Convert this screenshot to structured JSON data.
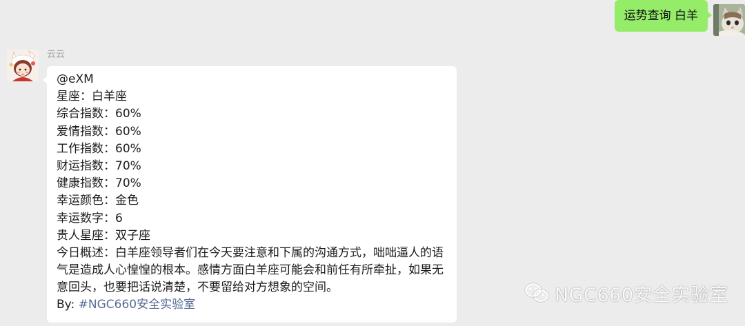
{
  "outgoing": {
    "text": "运势查询 白羊",
    "bubble_color": "#95ec69"
  },
  "incoming": {
    "sender": "云云",
    "lines": {
      "mention": "@eXM",
      "sign": "星座：白羊座",
      "overall": "综合指数：60%",
      "love": "爱情指数：60%",
      "work": "工作指数：60%",
      "wealth": "财运指数：70%",
      "health": "健康指数：70%",
      "lucky_color": "幸运颜色：金色",
      "lucky_number": "幸运数字：6",
      "noble_sign": "贵人星座：双子座",
      "summary": "今日概述：白羊座领导者们在今天要注意和下属的沟通方式，咄咄逼人的语气是造成人心惶惶的根本。感情方面白羊座可能会和前任有所牵扯，如果无意回头，也要把话说清楚，不要留给对方想象的空间。",
      "by_prefix": "By: ",
      "by_tag": "#NGC660安全实验室"
    },
    "hashtag_color": "#576b95"
  },
  "watermark": {
    "text": "NGC660安全实验室",
    "icon": "wechat-icon"
  },
  "avatars": {
    "self": "cat-avatar",
    "sender": "cartoon-girl-avatar"
  },
  "background_color": "#ececec"
}
